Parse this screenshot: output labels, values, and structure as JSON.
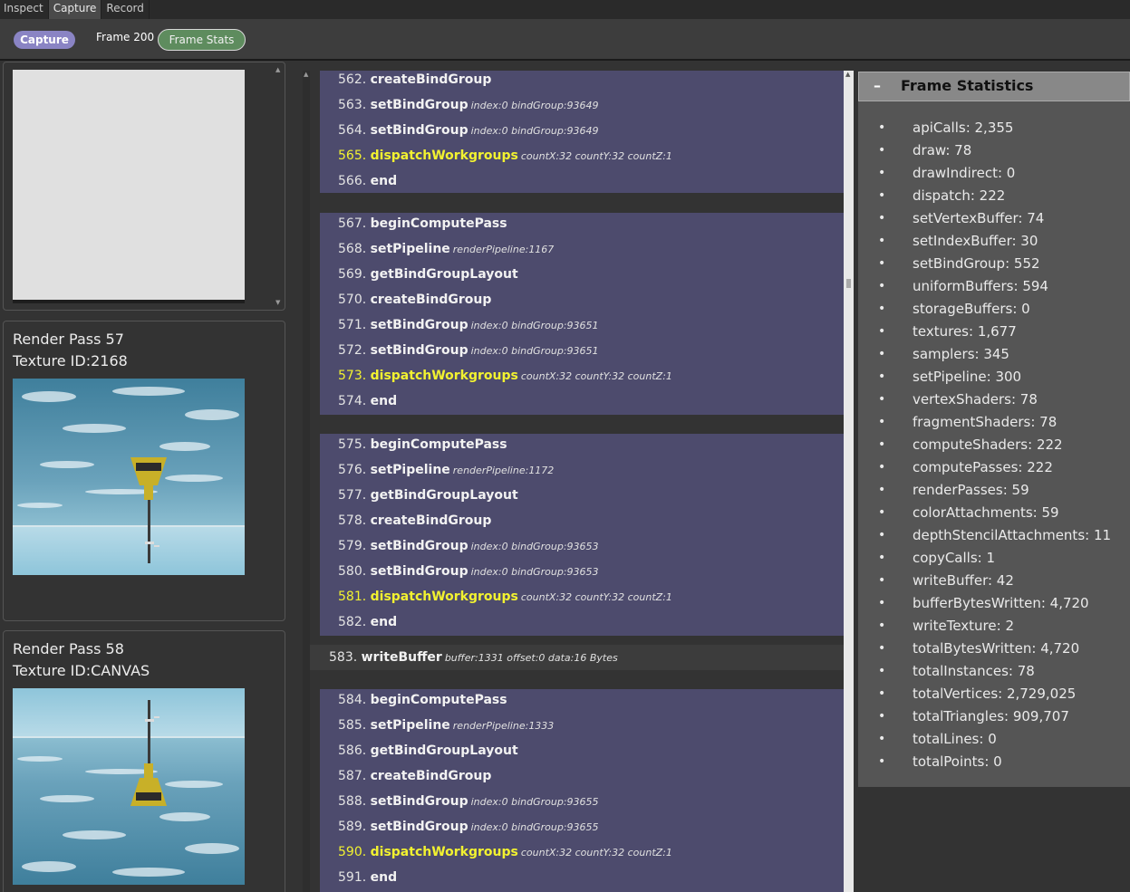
{
  "tabs": [
    "Inspect",
    "Capture",
    "Record"
  ],
  "active_tab": 1,
  "toolbar": {
    "capture_label": "Capture",
    "frame_label": "Frame 200",
    "stats_label": "Frame Stats"
  },
  "cards": [
    {
      "pass": "Render Pass 57",
      "texture": "Texture ID:2168"
    },
    {
      "pass": "Render Pass 58",
      "texture": "Texture ID:CANVAS"
    }
  ],
  "commands": {
    "block0": [
      {
        "num": "562.",
        "name": "createBindGroup",
        "args": ""
      },
      {
        "num": "563.",
        "name": "setBindGroup",
        "args": "index:0 bindGroup:93649"
      },
      {
        "num": "564.",
        "name": "setBindGroup",
        "args": "index:0 bindGroup:93649"
      },
      {
        "num": "565.",
        "name": "dispatchWorkgroups",
        "args": "countX:32 countY:32 countZ:1",
        "hl": true
      },
      {
        "num": "566.",
        "name": "end",
        "args": ""
      }
    ],
    "block1": [
      {
        "num": "567.",
        "name": "beginComputePass",
        "args": ""
      },
      {
        "num": "568.",
        "name": "setPipeline",
        "args": "renderPipeline:1167"
      },
      {
        "num": "569.",
        "name": "getBindGroupLayout",
        "args": ""
      },
      {
        "num": "570.",
        "name": "createBindGroup",
        "args": ""
      },
      {
        "num": "571.",
        "name": "setBindGroup",
        "args": "index:0 bindGroup:93651"
      },
      {
        "num": "572.",
        "name": "setBindGroup",
        "args": "index:0 bindGroup:93651"
      },
      {
        "num": "573.",
        "name": "dispatchWorkgroups",
        "args": "countX:32 countY:32 countZ:1",
        "hl": true
      },
      {
        "num": "574.",
        "name": "end",
        "args": ""
      }
    ],
    "block2": [
      {
        "num": "575.",
        "name": "beginComputePass",
        "args": ""
      },
      {
        "num": "576.",
        "name": "setPipeline",
        "args": "renderPipeline:1172"
      },
      {
        "num": "577.",
        "name": "getBindGroupLayout",
        "args": ""
      },
      {
        "num": "578.",
        "name": "createBindGroup",
        "args": ""
      },
      {
        "num": "579.",
        "name": "setBindGroup",
        "args": "index:0 bindGroup:93653"
      },
      {
        "num": "580.",
        "name": "setBindGroup",
        "args": "index:0 bindGroup:93653"
      },
      {
        "num": "581.",
        "name": "dispatchWorkgroups",
        "args": "countX:32 countY:32 countZ:1",
        "hl": true
      },
      {
        "num": "582.",
        "name": "end",
        "args": ""
      }
    ],
    "single": {
      "num": "583.",
      "name": "writeBuffer",
      "args": "buffer:1331 offset:0 data:16 Bytes"
    },
    "block3": [
      {
        "num": "584.",
        "name": "beginComputePass",
        "args": ""
      },
      {
        "num": "585.",
        "name": "setPipeline",
        "args": "renderPipeline:1333"
      },
      {
        "num": "586.",
        "name": "getBindGroupLayout",
        "args": ""
      },
      {
        "num": "587.",
        "name": "createBindGroup",
        "args": ""
      },
      {
        "num": "588.",
        "name": "setBindGroup",
        "args": "index:0 bindGroup:93655"
      },
      {
        "num": "589.",
        "name": "setBindGroup",
        "args": "index:0 bindGroup:93655"
      },
      {
        "num": "590.",
        "name": "dispatchWorkgroups",
        "args": "countX:32 countY:32 countZ:1",
        "hl": true
      },
      {
        "num": "591.",
        "name": "end",
        "args": ""
      }
    ]
  },
  "stats": {
    "collapse_symbol": "–",
    "title": "Frame Statistics",
    "items": [
      "apiCalls: 2,355",
      "draw: 78",
      "drawIndirect: 0",
      "dispatch: 222",
      "setVertexBuffer: 74",
      "setIndexBuffer: 30",
      "setBindGroup: 552",
      "uniformBuffers: 594",
      "storageBuffers: 0",
      "textures: 1,677",
      "samplers: 345",
      "setPipeline: 300",
      "vertexShaders: 78",
      "fragmentShaders: 78",
      "computeShaders: 222",
      "computePasses: 222",
      "renderPasses: 59",
      "colorAttachments: 59",
      "depthStencilAttachments: 11",
      "copyCalls: 1",
      "writeBuffer: 42",
      "bufferBytesWritten: 4,720",
      "writeTexture: 2",
      "totalBytesWritten: 4,720",
      "totalInstances: 78",
      "totalVertices: 2,729,025",
      "totalTriangles: 909,707",
      "totalLines: 0",
      "totalPoints: 0"
    ]
  },
  "colors": {
    "block_bg": "#4d4b6d",
    "highlight": "#f2f230",
    "capture_btn": "#8a84c4",
    "stats_btn": "#5e8c5e"
  }
}
